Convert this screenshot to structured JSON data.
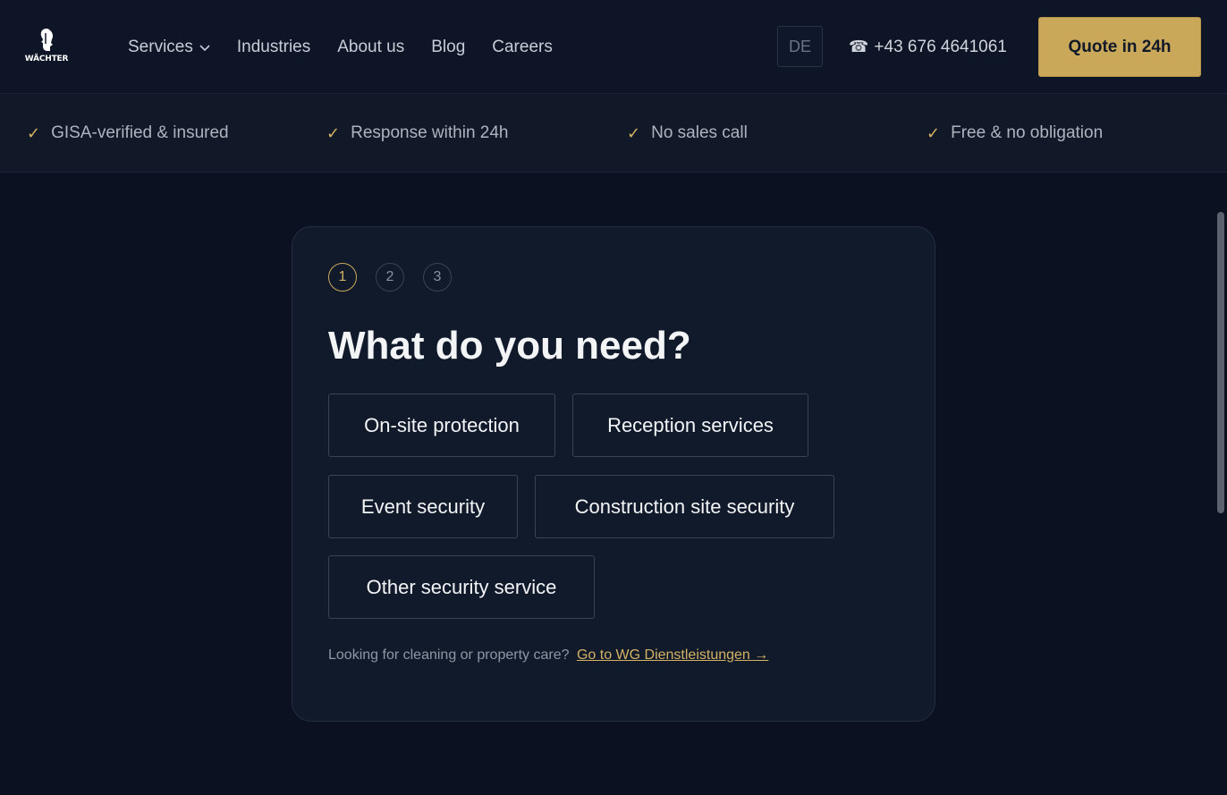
{
  "brand": {
    "logo_text": "WÄCHTER"
  },
  "nav": {
    "items": [
      {
        "label": "Services",
        "has_dropdown": true
      },
      {
        "label": "Industries"
      },
      {
        "label": "About us"
      },
      {
        "label": "Blog"
      },
      {
        "label": "Careers"
      }
    ],
    "language": "DE",
    "phone_icon": "☎",
    "phone": "+43 676 4641061",
    "cta": "Quote in 24h"
  },
  "trust_bar": [
    {
      "icon": "✓",
      "label": "GISA-verified & insured"
    },
    {
      "icon": "✓",
      "label": "Response within 24h"
    },
    {
      "icon": "✓",
      "label": "No sales call"
    },
    {
      "icon": "✓",
      "label": "Free & no obligation"
    }
  ],
  "wizard": {
    "steps": [
      "1",
      "2",
      "3"
    ],
    "active_step": 1,
    "title": "What do you need?",
    "options": [
      "On-site protection",
      "Reception services",
      "Event security",
      "Construction site security",
      "Other security service"
    ],
    "footnote_text": "Looking for cleaning or property care?",
    "footnote_link": "Go to WG Dienstleistungen →"
  },
  "colors": {
    "background": "#0b1120",
    "accent": "#c9a85a",
    "card": "#111a2b"
  }
}
